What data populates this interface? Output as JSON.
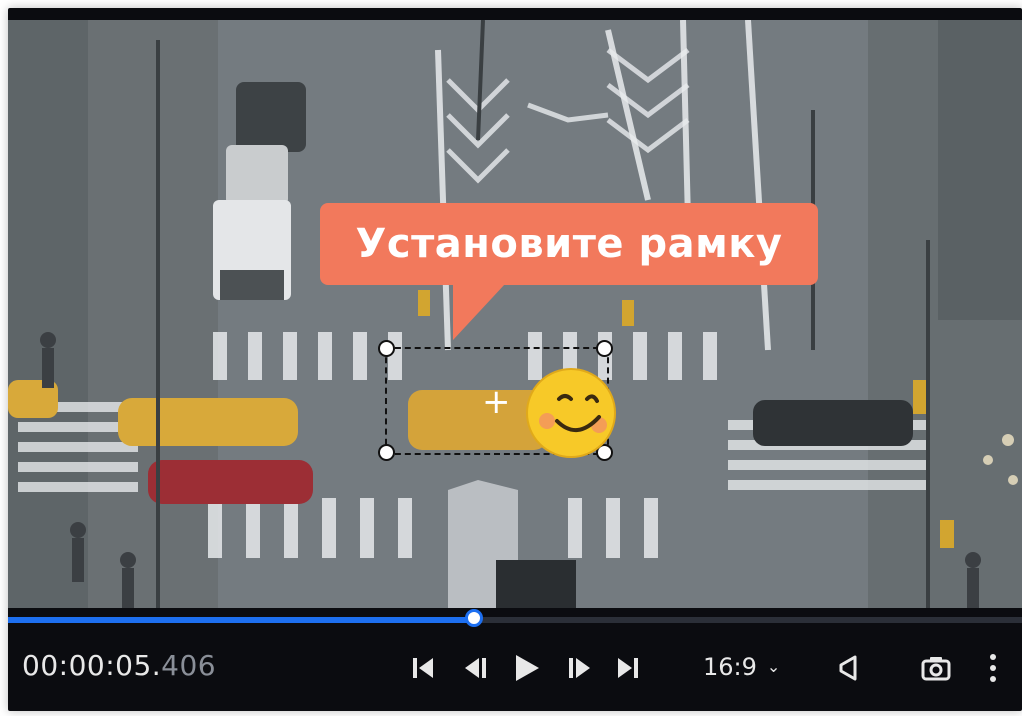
{
  "callout": {
    "text": "Установите рамку"
  },
  "player": {
    "timecode_main": "00:00:05.",
    "timecode_ms": "406",
    "progress": 0.46,
    "aspect_ratio": "16:9",
    "aspect_chevron": "⌄"
  },
  "icons": {
    "skip_start": "skip-to-start-icon",
    "prev_frame": "previous-frame-icon",
    "play": "play-icon",
    "next_frame": "next-frame-icon",
    "skip_end": "skip-to-end-icon",
    "audio": "audio-icon",
    "camera": "snapshot-camera-icon",
    "more": "more-vertical-icon",
    "sticker": "smiley-face-icon"
  },
  "colors": {
    "callout": "#f2795c",
    "accent": "#1d6ff0",
    "bar_bg": "#0b0c10",
    "sticker": "#f7c928"
  }
}
